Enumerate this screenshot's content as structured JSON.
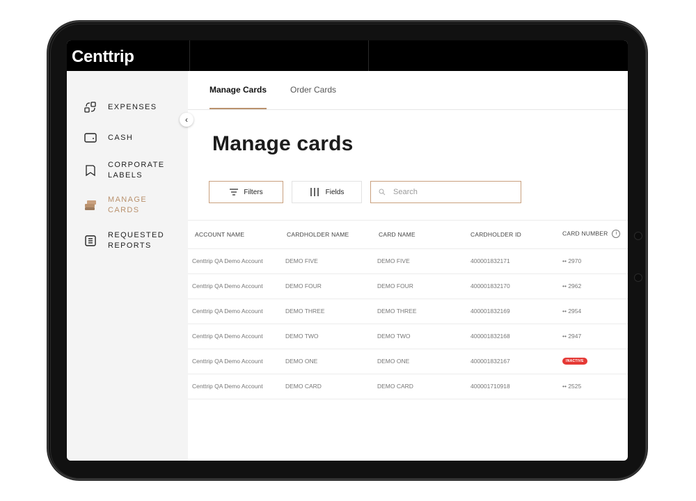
{
  "app": {
    "logo": "Centtrip"
  },
  "sidebar": {
    "items": [
      {
        "line1": "EXPENSES",
        "line2": "",
        "icon": "expenses-icon",
        "active": false
      },
      {
        "line1": "CASH",
        "line2": "",
        "icon": "wallet-icon",
        "active": false
      },
      {
        "line1": "CORPORATE",
        "line2": "LABELS",
        "icon": "label-icon",
        "active": false
      },
      {
        "line1": "MANAGE",
        "line2": "CARDS",
        "icon": "cards-icon",
        "active": true
      },
      {
        "line1": "REQUESTED",
        "line2": "REPORTS",
        "icon": "report-icon",
        "active": false
      }
    ]
  },
  "tabs": {
    "manage": "Manage Cards",
    "order": "Order Cards"
  },
  "page": {
    "title": "Manage cards"
  },
  "toolbar": {
    "filters_label": "Filters",
    "fields_label": "Fields",
    "search_placeholder": "Search"
  },
  "table": {
    "headers": [
      "ACCOUNT NAME",
      "CARDHOLDER NAME",
      "CARD NAME",
      "CARDHOLDER ID",
      "CARD NUMBER"
    ],
    "rows": [
      {
        "account": "Centtrip QA Demo Account",
        "holder": "DEMO FIVE",
        "card": "DEMO FIVE",
        "id": "400001832171",
        "number": "•• 2970",
        "status": ""
      },
      {
        "account": "Centtrip QA Demo Account",
        "holder": "DEMO FOUR",
        "card": "DEMO FOUR",
        "id": "400001832170",
        "number": "•• 2962",
        "status": ""
      },
      {
        "account": "Centtrip QA Demo Account",
        "holder": "DEMO THREE",
        "card": "DEMO THREE",
        "id": "400001832169",
        "number": "•• 2954",
        "status": ""
      },
      {
        "account": "Centtrip QA Demo Account",
        "holder": "DEMO TWO",
        "card": "DEMO TWO",
        "id": "400001832168",
        "number": "•• 2947",
        "status": ""
      },
      {
        "account": "Centtrip QA Demo Account",
        "holder": "DEMO ONE",
        "card": "DEMO ONE",
        "id": "400001832167",
        "number": "",
        "status": "INACTIVE"
      },
      {
        "account": "Centtrip QA Demo Account",
        "holder": "DEMO CARD",
        "card": "DEMO CARD",
        "id": "400001710918",
        "number": "•• 2525",
        "status": ""
      }
    ]
  },
  "colors": {
    "accent": "#b9916d",
    "inactive_badge": "#e53935",
    "sidebar_bg": "#f4f4f4",
    "header_bg": "#000000"
  }
}
